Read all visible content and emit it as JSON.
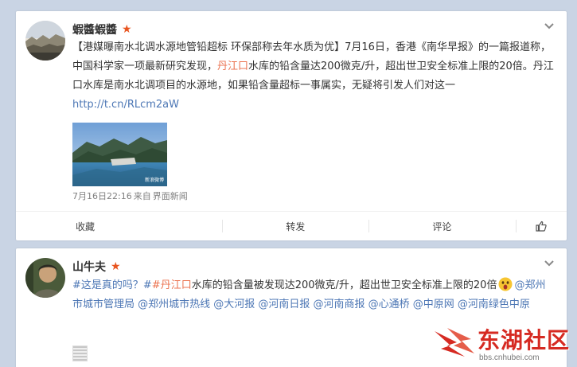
{
  "post1": {
    "username": "蝦醬蝦醬",
    "text_segments": [
      {
        "text": "【港媒曝南水北调水源地管铅超标 环保部称去年水质为优】7月16日，香港《南华早报》的一篇报道称，中国科学家一项最新研究发现，",
        "cls": ""
      },
      {
        "text": "丹江口",
        "cls": "hl"
      },
      {
        "text": "水库的铅含量达200微克/升，超出世卫安全标准上限的20倍。丹江口水库是南水北调项目的水源地，如果铅含量超标一事属实，无疑将引发人们对这一 ",
        "cls": ""
      },
      {
        "text": "http://t.cn/RLcm2aW",
        "cls": "lk"
      }
    ],
    "image_watermark": "新浪微博",
    "time": "7月16日22:16",
    "from_label": "来自",
    "source": "界面新闻",
    "actions": {
      "favorite": "收藏",
      "repost": "转发",
      "comment": "评论"
    }
  },
  "post2": {
    "username": "山牛夫",
    "text_segments": [
      {
        "text": "#这是真的吗？#",
        "cls": "lk"
      },
      {
        "text": "#丹江口",
        "cls": "hl"
      },
      {
        "text": "水库的铅含量被发现达200微克/升，超出世卫安全标准上限的20倍",
        "cls": ""
      },
      {
        "text": "[emoji]",
        "cls": "emoji"
      },
      {
        "text": "@郑州市城市管理局 @郑州城市热线 @大河报 @河南日报 @河南商报 @心通桥 @中原网 @河南绿色中原",
        "cls": "lk"
      }
    ]
  },
  "watermark": {
    "brand": "东湖社区",
    "url": "bbs.cnhubei.com"
  },
  "colors": {
    "background": "#c9d4e4",
    "highlight": "#eb7350",
    "link": "#4d77b5",
    "verified_star": "#e8541f"
  },
  "icons": {
    "verified": "star-icon",
    "menu": "chevron-down-icon",
    "like": "thumbs-up-icon"
  }
}
